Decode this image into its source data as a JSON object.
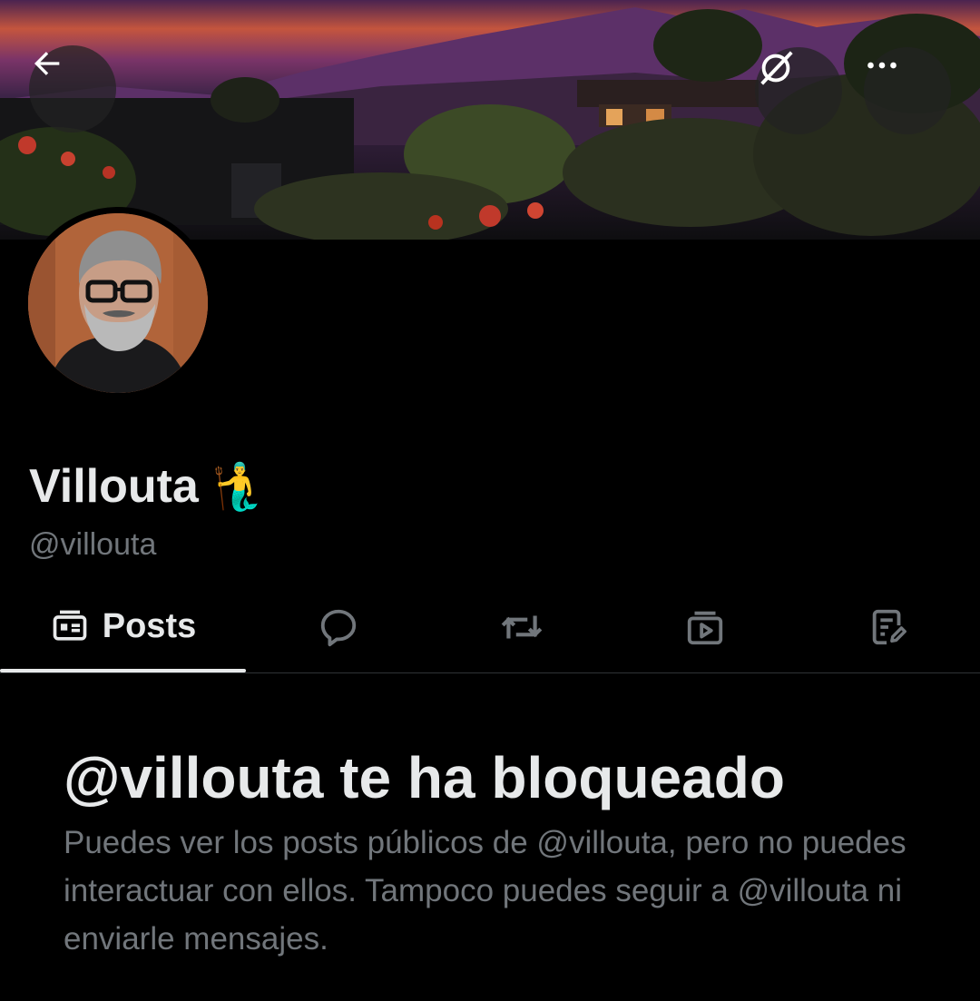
{
  "header": {
    "back_icon": "arrow-left-icon",
    "translate_icon": "translate-icon",
    "more_icon": "more-horizontal-icon"
  },
  "profile": {
    "display_name": "Villouta",
    "emoji": "🧜‍♂️",
    "handle": "@villouta"
  },
  "tabs": [
    {
      "label": "Posts",
      "icon": "posts-icon",
      "active": true
    },
    {
      "label": "",
      "icon": "replies-icon",
      "active": false
    },
    {
      "label": "",
      "icon": "reposts-icon",
      "active": false
    },
    {
      "label": "",
      "icon": "media-icon",
      "active": false
    },
    {
      "label": "",
      "icon": "articles-icon",
      "active": false
    }
  ],
  "blocked": {
    "title": "@villouta te ha bloqueado",
    "message": "Puedes ver los posts públicos de @villouta, pero no puedes interactuar con ellos. Tampoco puedes seguir a @villouta ni enviarle mensajes."
  },
  "colors": {
    "background": "#000000",
    "primary_text": "#e7e9ea",
    "secondary_text": "#71767b",
    "divider": "#2f3336"
  }
}
